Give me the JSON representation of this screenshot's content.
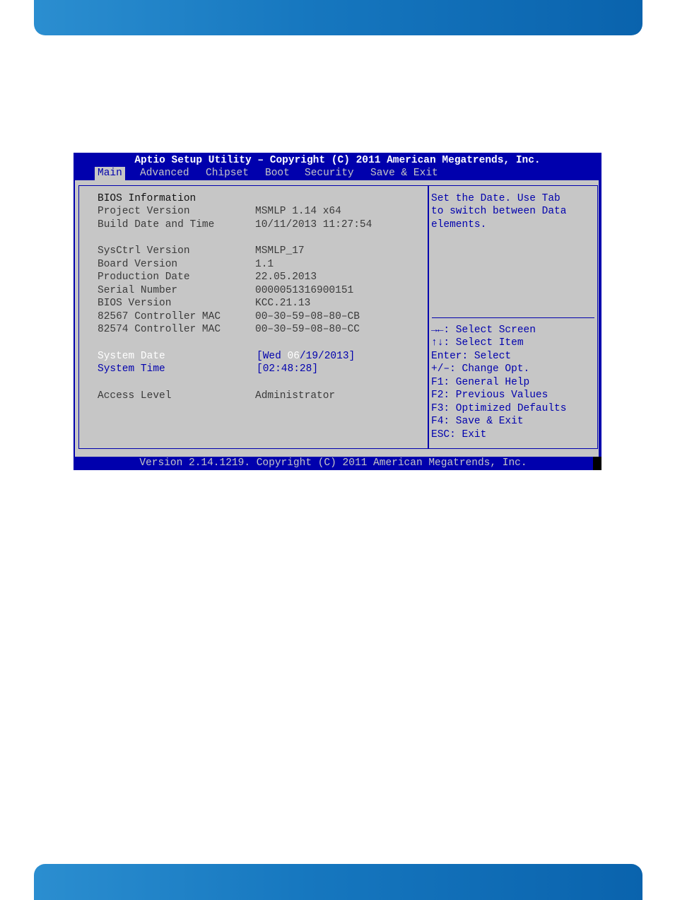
{
  "bios": {
    "title": "Aptio Setup Utility – Copyright (C) 2011 American Megatrends, Inc.",
    "tabs": [
      "Main",
      "Advanced",
      "Chipset",
      "Boot",
      "Security",
      "Save & Exit"
    ],
    "active_tab": "Main",
    "info": {
      "heading": "BIOS Information",
      "rows": [
        {
          "label": "Project Version",
          "value": "MSMLP 1.14 x64"
        },
        {
          "label": "Build Date and Time",
          "value": "10/11/2013 11:27:54"
        },
        {
          "label": "SysCtrl Version",
          "value": "MSMLP_17"
        },
        {
          "label": "Board Version",
          "value": "1.1"
        },
        {
          "label": "Production Date",
          "value": "22.05.2013"
        },
        {
          "label": "Serial Number",
          "value": "0000051316900151"
        },
        {
          "label": "BIOS Version",
          "value": "KCC.21.13"
        },
        {
          "label": "82567 Controller MAC",
          "value": "00–30–59–08–80–CB"
        },
        {
          "label": "82574 Controller MAC",
          "value": "00–30–59–08–80–CC"
        }
      ]
    },
    "system_date": {
      "label": "System Date",
      "prefix": "[Wed ",
      "highlight": "06",
      "suffix": "/19/2013]"
    },
    "system_time": {
      "label": "System Time",
      "value": "[02:48:28]"
    },
    "access_level": {
      "label": "Access Level",
      "value": "Administrator"
    },
    "help_text": [
      "Set the Date. Use Tab",
      "to switch between Data",
      "elements."
    ],
    "keys": [
      "→←: Select Screen",
      "↑↓: Select Item",
      "Enter: Select",
      "+/–: Change Opt.",
      "F1: General Help",
      "F2: Previous Values",
      "F3: Optimized Defaults",
      "F4: Save & Exit",
      "ESC: Exit"
    ],
    "footer": "Version 2.14.1219. Copyright (C) 2011 American Megatrends, Inc."
  },
  "colors": {
    "bios_blue": "#0000ad",
    "bios_gray": "#c6c6c6",
    "band_blue": "#1677bf"
  }
}
